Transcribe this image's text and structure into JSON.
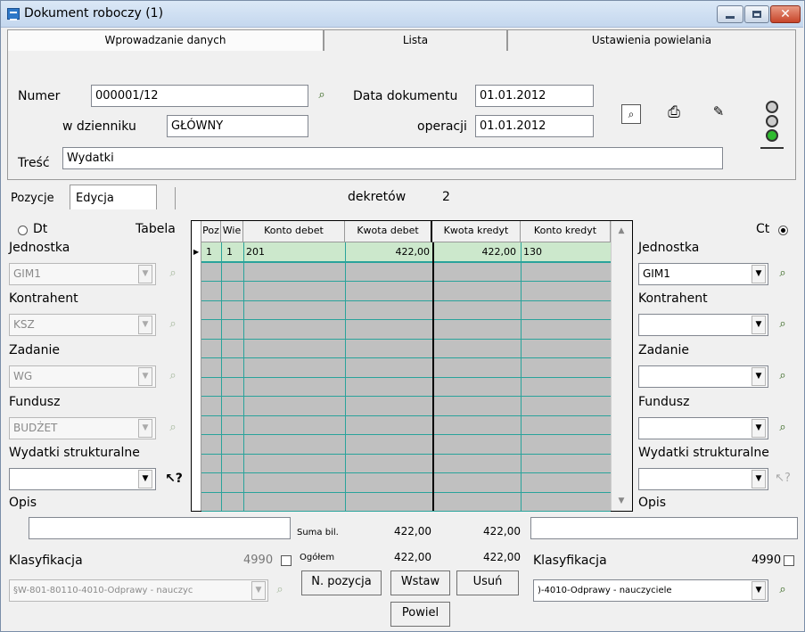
{
  "window": {
    "title": "Dokument roboczy (1)"
  },
  "tabs": [
    "Wprowadzanie danych",
    "Lista",
    "Ustawienia powielania"
  ],
  "header": {
    "numer_label": "Numer",
    "numer_value": "000001/12",
    "dziennik_label": "w dzienniku",
    "dziennik_value": "GŁÓWNY",
    "data_dok_label": "Data dokumentu",
    "data_dok_value": "01.01.2012",
    "data_op_label": "operacji",
    "data_op_value": "01.01.2012",
    "tresc_label": "Treść",
    "tresc_value": "Wydatki"
  },
  "subtabs": [
    "Pozycje",
    "Edycja"
  ],
  "dekretow": {
    "label": "dekretów",
    "value": "2"
  },
  "left": {
    "dt_label": "Dt",
    "tabela_label": "Tabela",
    "fields": [
      {
        "label": "Jednostka",
        "value": "GIM1"
      },
      {
        "label": "Kontrahent",
        "value": "KSZ"
      },
      {
        "label": "Zadanie",
        "value": "WG"
      },
      {
        "label": "Fundusz",
        "value": "BUDŻET"
      },
      {
        "label": "Wydatki strukturalne",
        "value": ""
      }
    ],
    "opis_label": "Opis",
    "klas_label": "Klasyfikacja",
    "klas_num": "4990",
    "klas_value": "§W-801-80110-4010-Odprawy - nauczyc"
  },
  "right": {
    "ct_label": "Ct",
    "fields": [
      {
        "label": "Jednostka",
        "value": "GIM1"
      },
      {
        "label": "Kontrahent",
        "value": ""
      },
      {
        "label": "Zadanie",
        "value": ""
      },
      {
        "label": "Fundusz",
        "value": ""
      },
      {
        "label": "Wydatki strukturalne",
        "value": ""
      }
    ],
    "opis_label": "Opis",
    "klas_label": "Klasyfikacja",
    "klas_num": "4990",
    "klas_value": ")-4010-Odprawy - nauczyciele"
  },
  "grid": {
    "headers": [
      "Poz",
      "Wie",
      "Konto debet",
      "Kwota debet",
      "Kwota kredyt",
      "Konto kredyt"
    ],
    "rows": [
      [
        "1",
        "1",
        "201",
        "422,00",
        "422,00",
        "130"
      ]
    ]
  },
  "sums": {
    "suma_label": "Suma bil.",
    "suma_debet": "422,00",
    "suma_kredyt": "422,00",
    "ogolem_label": "Ogółem",
    "ogolem_debet": "422,00",
    "ogolem_kredyt": "422,00"
  },
  "buttons": {
    "nowa": "N. pozycja",
    "wstaw": "Wstaw",
    "usun": "Usuń",
    "powiel": "Powiel"
  },
  "colors": {
    "row_selected": "#cce8cc",
    "grid_fill": "#c0c0c0",
    "grid_line": "#2aa39b"
  }
}
